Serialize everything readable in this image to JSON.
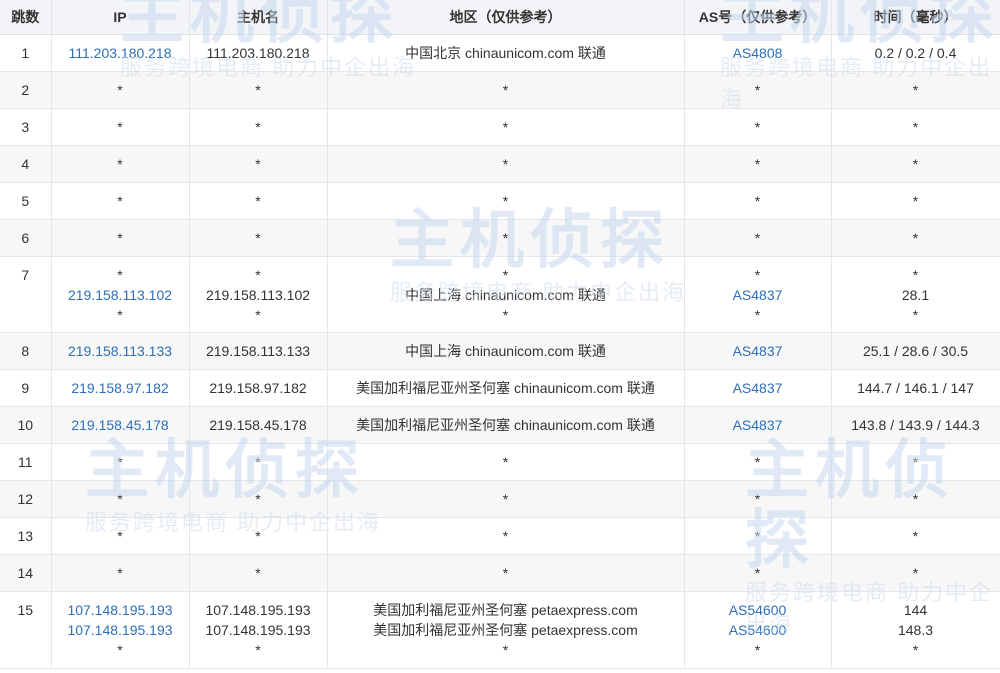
{
  "header": {
    "hop": "跳数",
    "ip": "IP",
    "host": "主机名",
    "region": "地区（仅供参考）",
    "asn": "AS号（仅供参考）",
    "time": "时间（毫秒）"
  },
  "rows": [
    {
      "hop": "1",
      "lines": [
        {
          "ip": "111.203.180.218",
          "host": "111.203.180.218",
          "region": "中国北京 chinaunicom.com 联通",
          "asn": "AS4808",
          "time": "0.2 / 0.2 / 0.4"
        }
      ]
    },
    {
      "hop": "2",
      "lines": [
        {
          "ip": "*",
          "host": "*",
          "region": "*",
          "asn": "*",
          "time": "*"
        }
      ]
    },
    {
      "hop": "3",
      "lines": [
        {
          "ip": "*",
          "host": "*",
          "region": "*",
          "asn": "*",
          "time": "*"
        }
      ]
    },
    {
      "hop": "4",
      "lines": [
        {
          "ip": "*",
          "host": "*",
          "region": "*",
          "asn": "*",
          "time": "*"
        }
      ]
    },
    {
      "hop": "5",
      "lines": [
        {
          "ip": "*",
          "host": "*",
          "region": "*",
          "asn": "*",
          "time": "*"
        }
      ]
    },
    {
      "hop": "6",
      "lines": [
        {
          "ip": "*",
          "host": "*",
          "region": "*",
          "asn": "*",
          "time": "*"
        }
      ]
    },
    {
      "hop": "7",
      "lines": [
        {
          "ip": "*",
          "host": "*",
          "region": "*",
          "asn": "*",
          "time": "*"
        },
        {
          "ip": "219.158.113.102",
          "host": "219.158.113.102",
          "region": "中国上海 chinaunicom.com 联通",
          "asn": "AS4837",
          "time": "28.1"
        },
        {
          "ip": "*",
          "host": "*",
          "region": "*",
          "asn": "*",
          "time": "*"
        }
      ]
    },
    {
      "hop": "8",
      "lines": [
        {
          "ip": "219.158.113.133",
          "host": "219.158.113.133",
          "region": "中国上海 chinaunicom.com 联通",
          "asn": "AS4837",
          "time": "25.1 / 28.6 / 30.5"
        }
      ]
    },
    {
      "hop": "9",
      "lines": [
        {
          "ip": "219.158.97.182",
          "host": "219.158.97.182",
          "region": "美国加利福尼亚州圣何塞 chinaunicom.com 联通",
          "asn": "AS4837",
          "time": "144.7 / 146.1 / 147"
        }
      ]
    },
    {
      "hop": "10",
      "lines": [
        {
          "ip": "219.158.45.178",
          "host": "219.158.45.178",
          "region": "美国加利福尼亚州圣何塞 chinaunicom.com 联通",
          "asn": "AS4837",
          "time": "143.8 / 143.9 / 144.3"
        }
      ]
    },
    {
      "hop": "11",
      "lines": [
        {
          "ip": "*",
          "host": "*",
          "region": "*",
          "asn": "*",
          "time": "*"
        }
      ]
    },
    {
      "hop": "12",
      "lines": [
        {
          "ip": "*",
          "host": "*",
          "region": "*",
          "asn": "*",
          "time": "*"
        }
      ]
    },
    {
      "hop": "13",
      "lines": [
        {
          "ip": "*",
          "host": "*",
          "region": "*",
          "asn": "*",
          "time": "*"
        }
      ]
    },
    {
      "hop": "14",
      "lines": [
        {
          "ip": "*",
          "host": "*",
          "region": "*",
          "asn": "*",
          "time": "*"
        }
      ]
    },
    {
      "hop": "15",
      "lines": [
        {
          "ip": "107.148.195.193",
          "host": "107.148.195.193",
          "region": "美国加利福尼亚州圣何塞 petaexpress.com",
          "asn": "AS54600",
          "time": "144"
        },
        {
          "ip": "107.148.195.193",
          "host": "107.148.195.193",
          "region": "美国加利福尼亚州圣何塞 petaexpress.com",
          "asn": "AS54600",
          "time": "148.3"
        },
        {
          "ip": "*",
          "host": "*",
          "region": "*",
          "asn": "*",
          "time": "*"
        }
      ]
    }
  ],
  "watermark": {
    "brand": "主机侦探",
    "slogan": "服务跨境电商 助力中企出海"
  },
  "colors": {
    "link": "#2d6fb8",
    "header_bg": "#f2f4f7",
    "stripe_bg": "#f7f7f7",
    "watermark": "#c7d8ee"
  }
}
